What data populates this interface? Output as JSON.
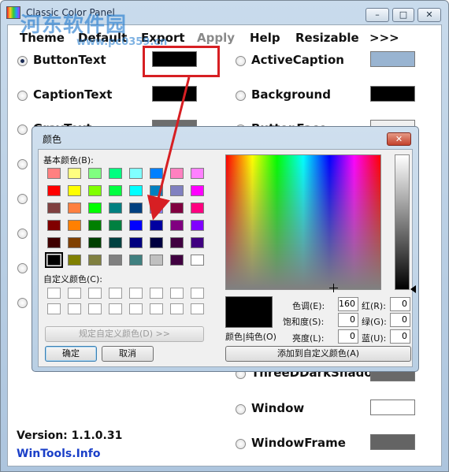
{
  "window": {
    "title": "Classic Color Panel",
    "minimize_glyph": "–",
    "maximize_glyph": "□",
    "close_glyph": "✕"
  },
  "watermark": {
    "text": "河东软件园",
    "url": "www.pc0359.cn"
  },
  "menu": {
    "theme": "Theme",
    "default": "Default",
    "export": "Export",
    "apply": "Apply",
    "help": "Help",
    "resizable": "Resizable",
    "more": ">>>"
  },
  "options": {
    "left": [
      {
        "label": "ButtonText",
        "selected": true,
        "color": "#000000"
      },
      {
        "label": "CaptionText",
        "selected": false,
        "color": "#000000"
      },
      {
        "label": "GrayText",
        "selected": false,
        "color": "#6d6d6d"
      }
    ],
    "right": [
      {
        "label": "ActiveCaption",
        "color": "#99b4d1"
      },
      {
        "label": "Background",
        "color": "#000000"
      },
      {
        "label": "ButtonFace",
        "color": "#f0f0f0"
      },
      {
        "label": "ThreeDDarkShadow",
        "color": "#696969"
      },
      {
        "label": "Window",
        "color": "#ffffff"
      },
      {
        "label": "WindowFrame",
        "color": "#646464"
      }
    ]
  },
  "footer": {
    "version": "Version: 1.1.0.31",
    "link": "WinTools.Info"
  },
  "color_dialog": {
    "title": "颜色",
    "close_glyph": "✕",
    "basic_colors_label": "基本颜色(B):",
    "custom_colors_label": "自定义颜色(C):",
    "define_custom_button": "规定自定义颜色(D) >>",
    "ok_button": "确定",
    "cancel_button": "取消",
    "color_solid_label": "颜色|纯色(O)",
    "add_custom_button": "添加到自定义颜色(A)",
    "hue_label": "色调(E):",
    "hue_value": "160",
    "sat_label": "饱和度(S):",
    "sat_value": "0",
    "lum_label": "亮度(L):",
    "lum_value": "0",
    "red_label": "红(R):",
    "red_value": "0",
    "green_label": "绿(G):",
    "green_value": "0",
    "blue_label": "蓝(U):",
    "blue_value": "0",
    "basic_colors": [
      [
        "#ff8080",
        "#ffff80",
        "#80ff80",
        "#00ff80",
        "#80ffff",
        "#0080ff",
        "#ff80c0",
        "#ff80ff"
      ],
      [
        "#ff0000",
        "#ffff00",
        "#80ff00",
        "#00ff40",
        "#00ffff",
        "#0080c0",
        "#8080c0",
        "#ff00ff"
      ],
      [
        "#804040",
        "#ff8040",
        "#00ff00",
        "#008080",
        "#004080",
        "#8080ff",
        "#800040",
        "#ff0080"
      ],
      [
        "#800000",
        "#ff8000",
        "#008000",
        "#008040",
        "#0000ff",
        "#0000a0",
        "#800080",
        "#8000ff"
      ],
      [
        "#400000",
        "#804000",
        "#004000",
        "#004040",
        "#000080",
        "#000040",
        "#400040",
        "#400080"
      ],
      [
        "#000000",
        "#808000",
        "#808040",
        "#808080",
        "#408080",
        "#c0c0c0",
        "#400040",
        "#ffffff"
      ]
    ],
    "selected_basic": [
      5,
      0
    ],
    "preview_color": "#000000"
  }
}
